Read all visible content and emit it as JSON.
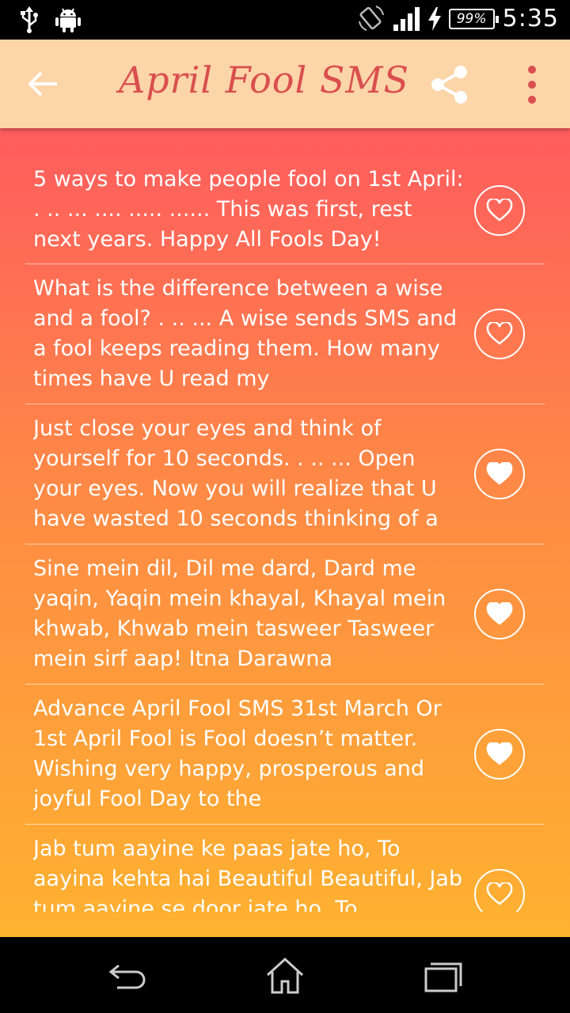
{
  "status_bar": {
    "battery": "99%",
    "time": "5:35",
    "icons": [
      "usb-icon",
      "android-icon",
      "rotate-icon",
      "signal-icon",
      "charging-icon"
    ]
  },
  "app_bar": {
    "title": "April Fool SMS",
    "icons": [
      "back-arrow-icon",
      "share-icon",
      "more-vert-icon"
    ],
    "title_color": "#d94f4f",
    "background": "#fcd5a8"
  },
  "messages": [
    {
      "text": "5 ways to make people fool on 1st April: . .. ... .... ..... ...... This was first, rest next years. Happy All Fools Day!",
      "favorite": false
    },
    {
      "text": "What is the difference between a wise and a fool? . .. ... A wise sends SMS and a fool keeps reading them. How many times have U read my",
      "favorite": false
    },
    {
      "text": "Just close your eyes and think of yourself for 10 seconds. . .. ... Open your eyes. Now you will realize that U have wasted 10 seconds thinking of a",
      "favorite": true
    },
    {
      "text": "Sine mein dil, Dil me dard, Dard me yaqin, Yaqin mein khayal, Khayal mein khwab, Khwab mein tasweer Tasweer mein sirf aap! Itna Darawna",
      "favorite": true
    },
    {
      "text": "Advance April Fool SMS 31st March Or 1st April Fool is Fool doesn’t matter. Wishing very happy, prosperous and joyful Fool Day to the",
      "favorite": true
    },
    {
      "text": "Jab tum aayine ke paas jate ho, To aayina kehta hai Beautiful Beautiful, Jab tum aayine se door jate ho, To",
      "favorite": false
    }
  ],
  "nav_bar": {
    "icons": [
      "nav-back-icon",
      "nav-home-icon",
      "nav-recents-icon"
    ]
  },
  "colors": {
    "gradient_top": "#ff5c5e",
    "gradient_bottom": "#ffb230",
    "text": "#ffffff"
  }
}
